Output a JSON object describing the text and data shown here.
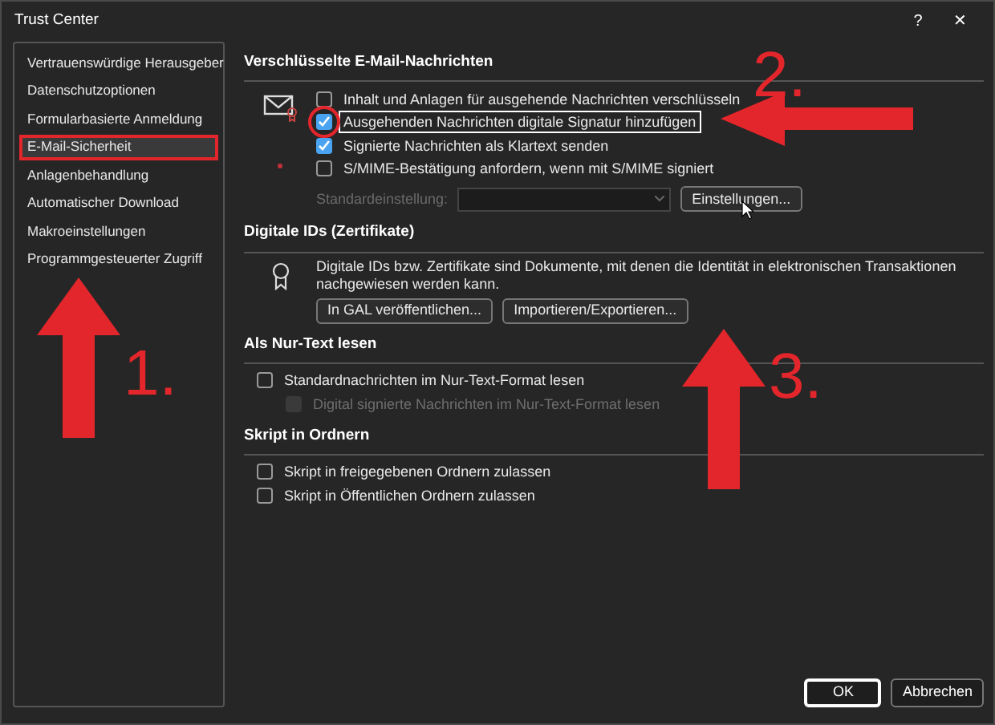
{
  "window": {
    "title": "Trust Center",
    "help_button": "?",
    "close_button": "✕"
  },
  "sidebar": {
    "items": [
      {
        "label": "Vertrauenswürdige Herausgeber",
        "selected": false,
        "highlighted": false
      },
      {
        "label": "Datenschutzoptionen",
        "selected": false,
        "highlighted": false
      },
      {
        "label": "Formularbasierte Anmeldung",
        "selected": false,
        "highlighted": false
      },
      {
        "label": "E-Mail-Sicherheit",
        "selected": true,
        "highlighted": true
      },
      {
        "label": "Anlagenbehandlung",
        "selected": false,
        "highlighted": false
      },
      {
        "label": "Automatischer Download",
        "selected": false,
        "highlighted": false
      },
      {
        "label": "Makroeinstellungen",
        "selected": false,
        "highlighted": false
      },
      {
        "label": "Programmgesteuerter Zugriff",
        "selected": false,
        "highlighted": false
      }
    ]
  },
  "encrypted_email": {
    "title": "Verschlüsselte E-Mail-Nachrichten",
    "options": [
      {
        "label": "Inhalt und Anlagen für ausgehende Nachrichten verschlüsseln",
        "checked": false,
        "focused": false,
        "circled": false
      },
      {
        "label": "Ausgehenden Nachrichten digitale Signatur hinzufügen",
        "checked": true,
        "focused": true,
        "circled": true
      },
      {
        "label": "Signierte Nachrichten als Klartext senden",
        "checked": true,
        "focused": false,
        "circled": false
      },
      {
        "label": "S/MIME-Bestätigung anfordern, wenn mit S/MIME signiert",
        "checked": false,
        "focused": false,
        "circled": false
      }
    ],
    "default_setting": {
      "label": "Standardeinstellung:",
      "disabled": true
    },
    "settings_button": "Einstellungen..."
  },
  "digital_ids": {
    "title": "Digitale IDs (Zertifikate)",
    "description": "Digitale IDs bzw. Zertifikate sind Dokumente, mit denen die Identität in elektronischen Transaktionen nachgewiesen werden kann.",
    "buttons": [
      "In GAL veröffentlichen...",
      "Importieren/Exportieren..."
    ]
  },
  "plain_text": {
    "title": "Als Nur-Text lesen",
    "options": [
      {
        "label": "Standardnachrichten im Nur-Text-Format lesen",
        "checked": false,
        "disabled": false,
        "children": [
          {
            "label": "Digital signierte Nachrichten im Nur-Text-Format lesen",
            "checked": false,
            "disabled": true
          }
        ]
      }
    ]
  },
  "scripts": {
    "title": "Skript in Ordnern",
    "options": [
      {
        "label": "Skript in freigegebenen Ordnern zulassen",
        "checked": false,
        "disabled": false
      },
      {
        "label": "Skript in Öffentlichen Ordnern zulassen",
        "checked": false,
        "disabled": false
      }
    ]
  },
  "footer_buttons": [
    {
      "label": "OK",
      "default": true
    },
    {
      "label": "Abbrechen",
      "default": false
    }
  ],
  "annotations": [
    {
      "label": "1.",
      "kind": "up"
    },
    {
      "label": "2.",
      "kind": "left"
    },
    {
      "label": "3.",
      "kind": "up"
    }
  ]
}
